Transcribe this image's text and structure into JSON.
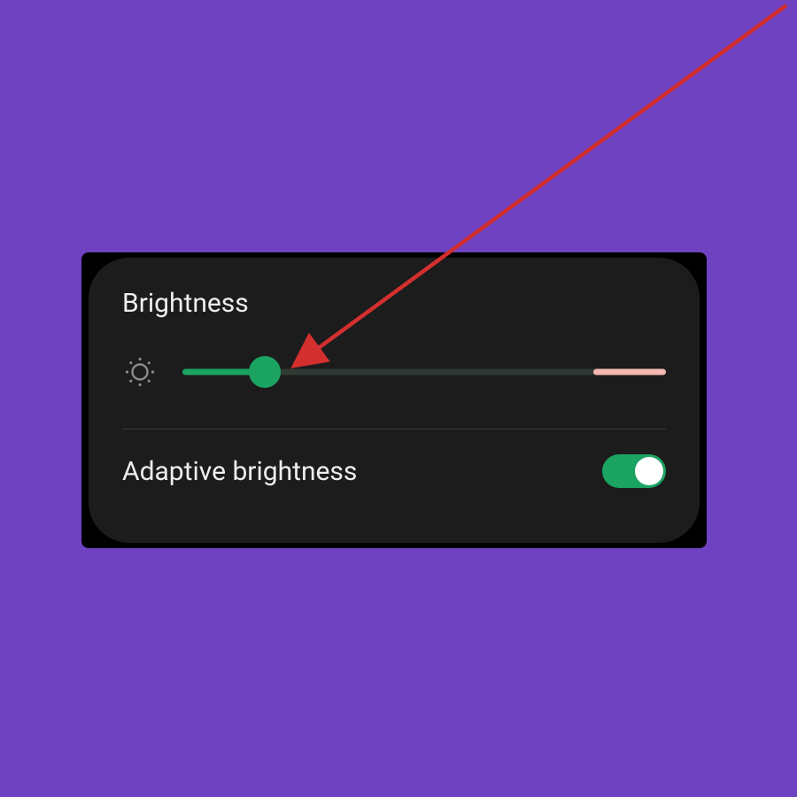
{
  "brightness": {
    "title": "Brightness",
    "adaptive_label": "Adaptive brightness",
    "adaptive_on": true,
    "slider_percent": 17,
    "high_zone_percent": 15
  },
  "colors": {
    "accent": "#1ba362",
    "high_zone": "#f5b8b0",
    "panel": "#1c1c1c",
    "arrow": "#d32f2f"
  }
}
